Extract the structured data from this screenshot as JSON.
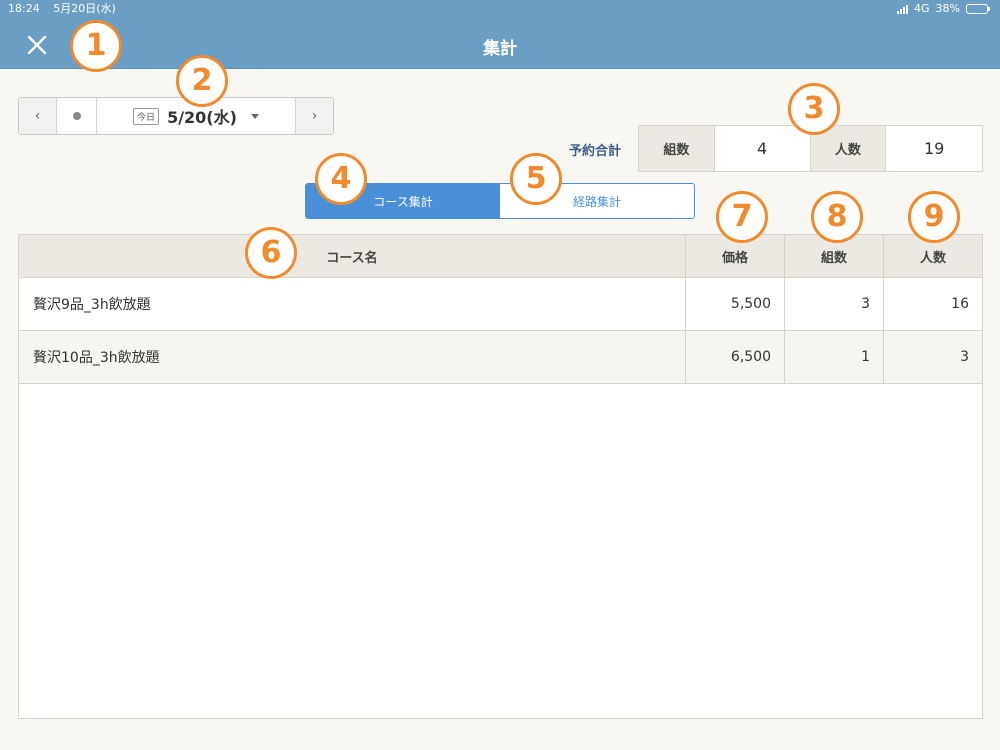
{
  "status_bar": {
    "time": "18:24",
    "date": "5月20日(水)",
    "network": "4G",
    "battery": "38%",
    "battery_level": 0.38
  },
  "header": {
    "title": "集計",
    "close_icon": "close-icon"
  },
  "date_nav": {
    "today_tag": "今日",
    "date": "5/20(水)",
    "prev_symbol": "‹",
    "next_symbol": "›"
  },
  "totals": {
    "label": "予約合計",
    "groups_label": "組数",
    "groups_value": "4",
    "people_label": "人数",
    "people_value": "19"
  },
  "tabs": [
    {
      "label": "コース集計",
      "active": true
    },
    {
      "label": "経路集計",
      "active": false
    }
  ],
  "table": {
    "headers": [
      "コース名",
      "価格",
      "組数",
      "人数"
    ],
    "rows": [
      [
        "贅沢9品_3h飲放題",
        "5,500",
        "3",
        "16"
      ],
      [
        "贅沢10品_3h飲放題",
        "6,500",
        "1",
        "3"
      ]
    ]
  },
  "annotations": [
    "1",
    "2",
    "3",
    "4",
    "5",
    "6",
    "7",
    "8",
    "9"
  ],
  "colors": {
    "header_bg": "#6a9ec5",
    "accent": "#4a90d9",
    "annotation": "#f08a2c",
    "label_blue": "#3d5d86"
  }
}
